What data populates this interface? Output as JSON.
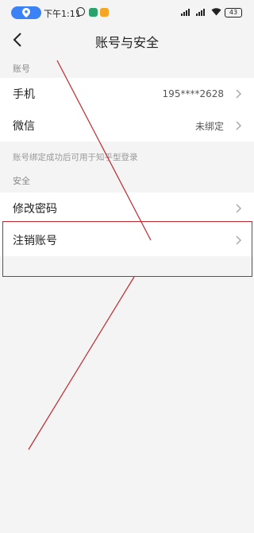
{
  "status_bar": {
    "time": "下午1:11",
    "battery": "43",
    "network_1": "4G",
    "network_2": "4G"
  },
  "nav": {
    "title": "账号与安全"
  },
  "sections": {
    "account_header": "账号",
    "account_note": "账号绑定成功后可用于知乎型登录",
    "security_header": "安全"
  },
  "rows": {
    "phone": {
      "label": "手机",
      "value": "195****2628"
    },
    "wechat": {
      "label": "微信",
      "value": "未绑定"
    },
    "change_password": {
      "label": "修改密码"
    },
    "delete_account": {
      "label": "注销账号"
    }
  },
  "colors": {
    "accent": "#3b82f6",
    "annotation": "#c0272d",
    "background": "#f4f4f4"
  }
}
